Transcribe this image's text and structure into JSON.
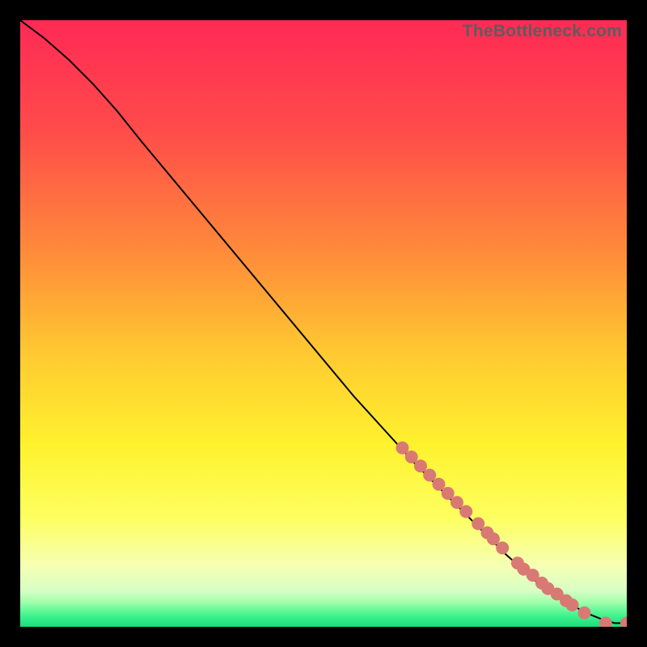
{
  "watermark": "TheBottleneck.com",
  "chart_data": {
    "type": "line",
    "title": "",
    "xlabel": "",
    "ylabel": "",
    "xlim": [
      0,
      100
    ],
    "ylim": [
      0,
      100
    ],
    "series": [
      {
        "name": "curve",
        "x": [
          0,
          4,
          8,
          12,
          16,
          20,
          25,
          30,
          35,
          40,
          45,
          50,
          55,
          60,
          65,
          70,
          75,
          80,
          85,
          88,
          90,
          92,
          94,
          96,
          98,
          100
        ],
        "y": [
          100,
          97,
          93.5,
          89.5,
          85,
          80,
          74,
          68,
          62,
          56,
          50,
          44,
          38,
          32.5,
          27,
          22,
          17,
          12,
          7.5,
          5.5,
          4.2,
          3.0,
          2.0,
          1.2,
          0.6,
          0.6
        ]
      }
    ],
    "scatter_points": {
      "name": "highlighted-points",
      "x": [
        63,
        64.5,
        66,
        67.5,
        69,
        70.5,
        72,
        73.5,
        75.5,
        77,
        78,
        79.5,
        82,
        83,
        84.5,
        86,
        87,
        88.5,
        90,
        91,
        93,
        96.5,
        100
      ],
      "y": [
        29.5,
        28.0,
        26.5,
        25.0,
        23.5,
        22.0,
        20.5,
        19.0,
        17.0,
        15.5,
        14.5,
        13.0,
        10.5,
        9.5,
        8.5,
        7.2,
        6.3,
        5.4,
        4.3,
        3.6,
        2.3,
        0.6,
        0.6
      ],
      "color": "#d87a73",
      "radius_px": 8
    },
    "gradient_stops": [
      {
        "pct": 0,
        "color": "#ff2a55"
      },
      {
        "pct": 18,
        "color": "#ff4b4a"
      },
      {
        "pct": 38,
        "color": "#ff8a3a"
      },
      {
        "pct": 55,
        "color": "#ffc931"
      },
      {
        "pct": 70,
        "color": "#fff22e"
      },
      {
        "pct": 82,
        "color": "#fdff60"
      },
      {
        "pct": 90,
        "color": "#f6ffb3"
      },
      {
        "pct": 94,
        "color": "#d8ffc5"
      },
      {
        "pct": 96,
        "color": "#9effac"
      },
      {
        "pct": 98,
        "color": "#45f48e"
      },
      {
        "pct": 100,
        "color": "#17e07d"
      }
    ]
  }
}
